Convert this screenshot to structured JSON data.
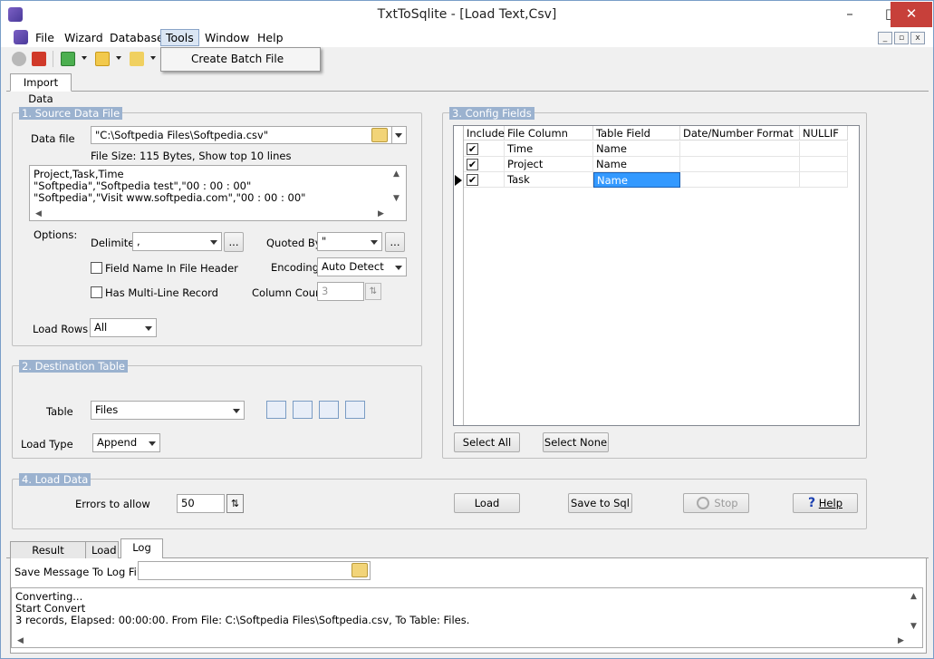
{
  "window": {
    "title": "TxtToSqlite - [Load Text,Csv]",
    "minimize": "–",
    "maximize": "□",
    "close": "✕"
  },
  "menu": {
    "items": [
      "File",
      "Wizard",
      "Database",
      "Tools",
      "Window",
      "Help"
    ],
    "open_item": "Tools"
  },
  "tools_menu": {
    "items": [
      "Create Batch File"
    ]
  },
  "tabs": {
    "main": [
      "Import Data"
    ]
  },
  "source": {
    "legend": "1. Source Data File",
    "data_file_label": "Data file",
    "data_file_value": "\"C:\\Softpedia Files\\Softpedia.csv\"",
    "file_info": "File Size: 115 Bytes,  Show top 10 lines",
    "preview_lines": [
      "Project,Task,Time",
      "\"Softpedia\",\"Softpedia test\",\"00 : 00 : 00\"",
      "\"Softpedia\",\"Visit www.softpedia.com\",\"00 : 00 : 00\""
    ],
    "options_label": "Options:",
    "delimiter_label": "Delimiter",
    "delimiter_value": ",",
    "quoted_by_label": "Quoted By",
    "quoted_by_value": "\"",
    "ellipsis": "...",
    "field_name_header_label": "Field Name In File Header",
    "field_name_header_checked": false,
    "multiline_label": "Has Multi-Line Record",
    "multiline_checked": false,
    "encoding_label": "Encoding",
    "encoding_value": "Auto Detect",
    "column_count_label": "Column Count",
    "column_count_value": "3",
    "load_rows_label": "Load Rows",
    "load_rows_value": "All"
  },
  "destination": {
    "legend": "2. Destination Table",
    "table_label": "Table",
    "table_value": "Files",
    "load_type_label": "Load Type",
    "load_type_value": "Append"
  },
  "config": {
    "legend": "3. Config Fields",
    "columns": [
      "Include",
      "File Column",
      "Table Field",
      "Date/Number Format",
      "NULLIF"
    ],
    "rows": [
      {
        "include": true,
        "file_column": "Time",
        "table_field": "Name",
        "format": "",
        "nullif": ""
      },
      {
        "include": true,
        "file_column": "Project",
        "table_field": "Name",
        "format": "",
        "nullif": ""
      },
      {
        "include": true,
        "file_column": "Task",
        "table_field": "Name",
        "format": "",
        "nullif": ""
      }
    ],
    "select_all": "Select All",
    "select_none": "Select None"
  },
  "load": {
    "legend": "4. Load Data",
    "errors_label": "Errors to allow",
    "errors_value": "50",
    "load_btn": "Load",
    "save_btn": "Save to Sql",
    "stop_btn": "Stop",
    "help_btn": "Help"
  },
  "bottom": {
    "tabs": [
      "Result Preview",
      "Load",
      "Log"
    ],
    "active_tab": "Log",
    "log_file_label": "Save Message To Log File",
    "log_file_value": "",
    "log_lines": [
      "Converting...",
      "Start Convert",
      "3 records,    Elapsed: 00:00:00.    From File: C:\\Softpedia Files\\Softpedia.csv,    To Table: Files."
    ]
  },
  "colors": {
    "accent": "#9bb2cf",
    "selection": "#3399ff",
    "close": "#c7403a"
  }
}
